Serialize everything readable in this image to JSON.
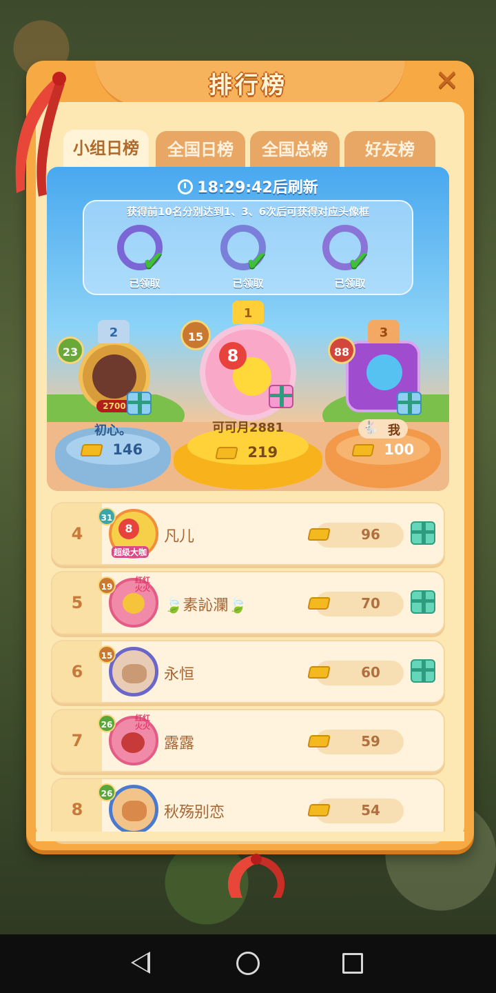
{
  "panel": {
    "title": "排行榜",
    "close_icon": "close-icon"
  },
  "tabs": [
    {
      "label": "小组日榜",
      "active": true
    },
    {
      "label": "全国日榜",
      "active": false
    },
    {
      "label": "全国总榜",
      "active": false
    },
    {
      "label": "好友榜",
      "active": false
    }
  ],
  "timer": {
    "text": "18:29:42后刷新"
  },
  "frames": {
    "hint": "获得前10名分别达到1、3、6次后可获得对应头像框",
    "items": [
      {
        "label": "已领取"
      },
      {
        "label": "已领取"
      },
      {
        "label": "已领取"
      }
    ]
  },
  "podium": {
    "second": {
      "rank": "2",
      "level": "23",
      "name": "初心。",
      "score": "146",
      "tag": "2700"
    },
    "first": {
      "rank": "1",
      "level": "15",
      "name": "可可月2881",
      "score": "219",
      "avatar_num": "8"
    },
    "third": {
      "rank": "3",
      "level": "88",
      "name": "我",
      "score": "100"
    }
  },
  "list": [
    {
      "rank": "4",
      "level": "31",
      "name": "凡儿",
      "score": "96",
      "tag": "超级大咖",
      "avatar_num": "8",
      "gift": true
    },
    {
      "rank": "5",
      "level": "19",
      "name": "🍃素訫瀾🍃",
      "score": "70",
      "tag": "红红火火",
      "gift": true
    },
    {
      "rank": "6",
      "level": "15",
      "name": "永恒",
      "score": "60",
      "gift": true
    },
    {
      "rank": "7",
      "level": "26",
      "name": "露露",
      "score": "59",
      "tag": "红红火火",
      "gift": false
    },
    {
      "rank": "8",
      "level": "26",
      "name": "秋殇别恋",
      "score": "54",
      "gift": false
    }
  ],
  "colors": {
    "panel_orange": "#f7a943",
    "panel_cream": "#fde7b3",
    "check_green": "#3fbf3a",
    "gold": "#f4b91e"
  }
}
